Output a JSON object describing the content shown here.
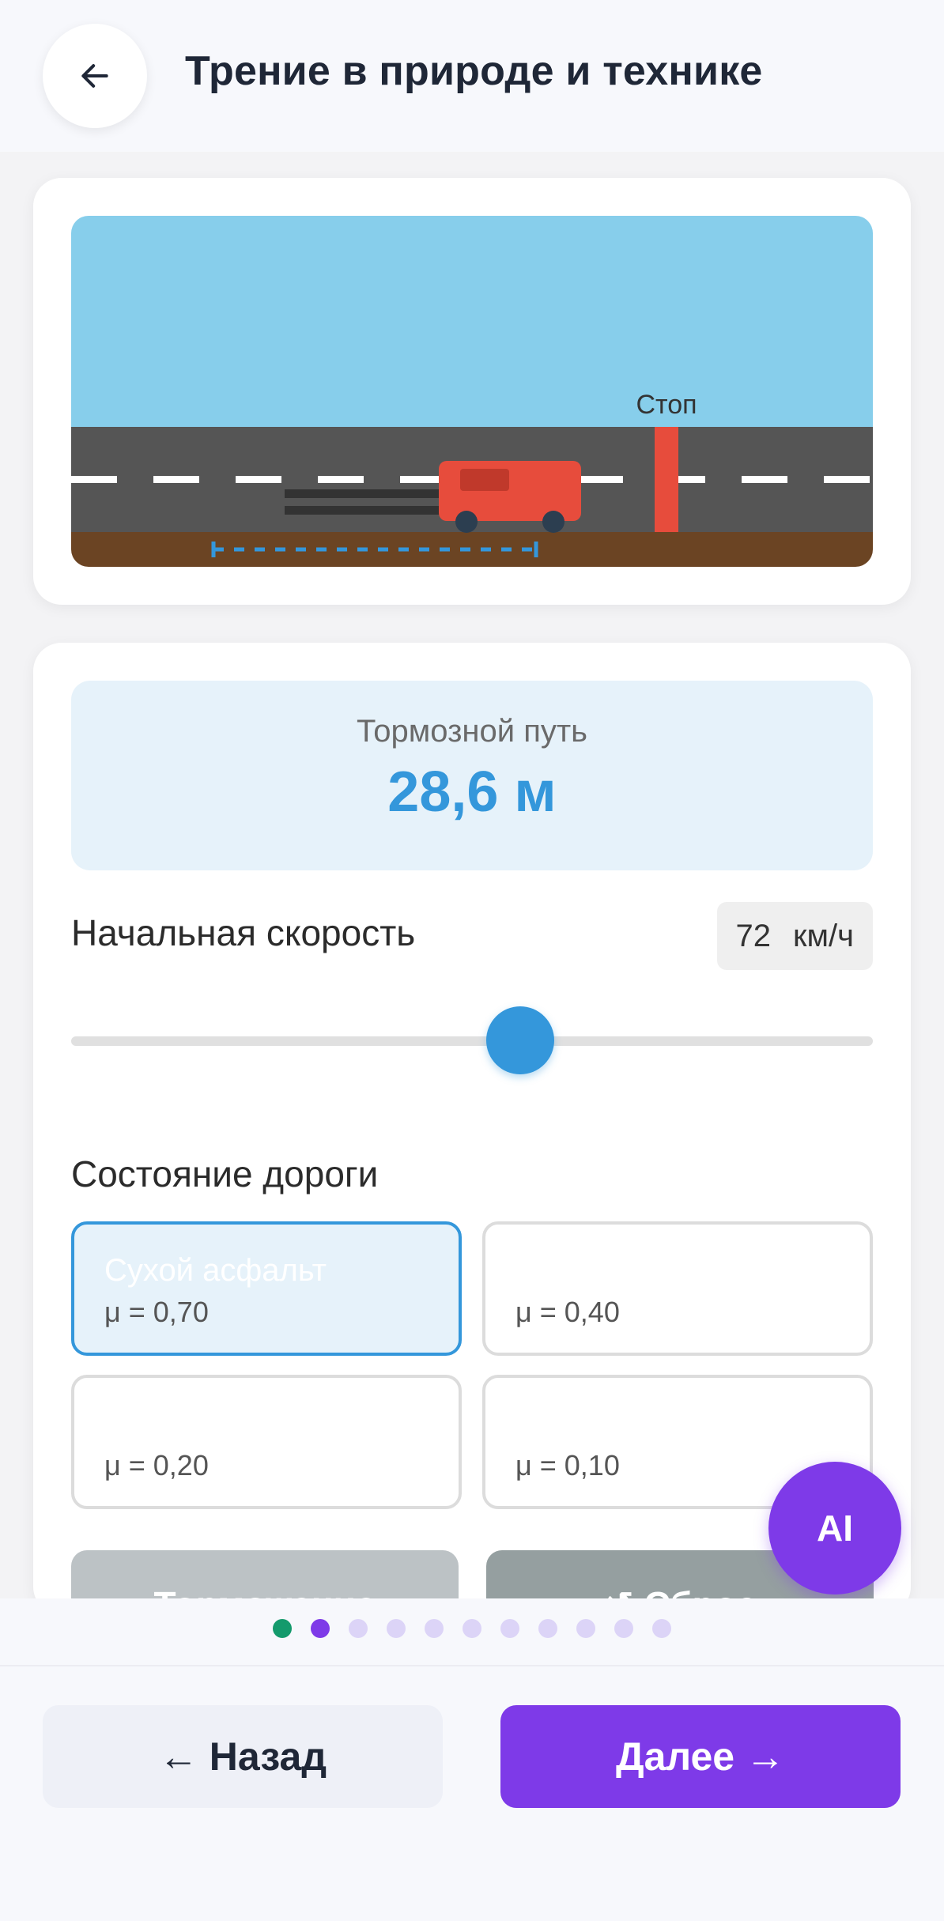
{
  "header": {
    "title": "Трение в природе и технике",
    "back_icon": "arrow-left-icon"
  },
  "scene": {
    "stop_label": "Стоп",
    "colors": {
      "sky": "#87ceeb",
      "road": "#555555",
      "ground": "#6b4423",
      "car": "#e74c3c",
      "stop_post": "#e74c3c",
      "distance_marker": "#3497db"
    }
  },
  "controls": {
    "stopping_distance_label": "Тормозной путь",
    "stopping_distance_value": "28,6 м",
    "speed_label": "Начальная скорость",
    "speed_value": "72",
    "speed_unit": "км/ч",
    "speed_slider_fraction": 0.56,
    "road_label": "Состояние дороги",
    "road_options": [
      {
        "name": "Сухой асфальт",
        "mu": "μ = 0,70",
        "selected": true
      },
      {
        "name": "",
        "mu": "μ = 0,40",
        "selected": false
      },
      {
        "name": "",
        "mu": "μ = 0,20",
        "selected": false
      },
      {
        "name": "",
        "mu": "μ = 0,10",
        "selected": false
      }
    ],
    "brake_button": "Торможение",
    "reset_button": "↺ Сброс"
  },
  "ai_button": "AI",
  "progress": {
    "total": 11,
    "current": 2,
    "colors": {
      "done": "#149a6c",
      "current": "#7e3ae8",
      "pending": "#dcd4f7"
    }
  },
  "nav": {
    "back": "← Назад",
    "next": "Далее →"
  }
}
